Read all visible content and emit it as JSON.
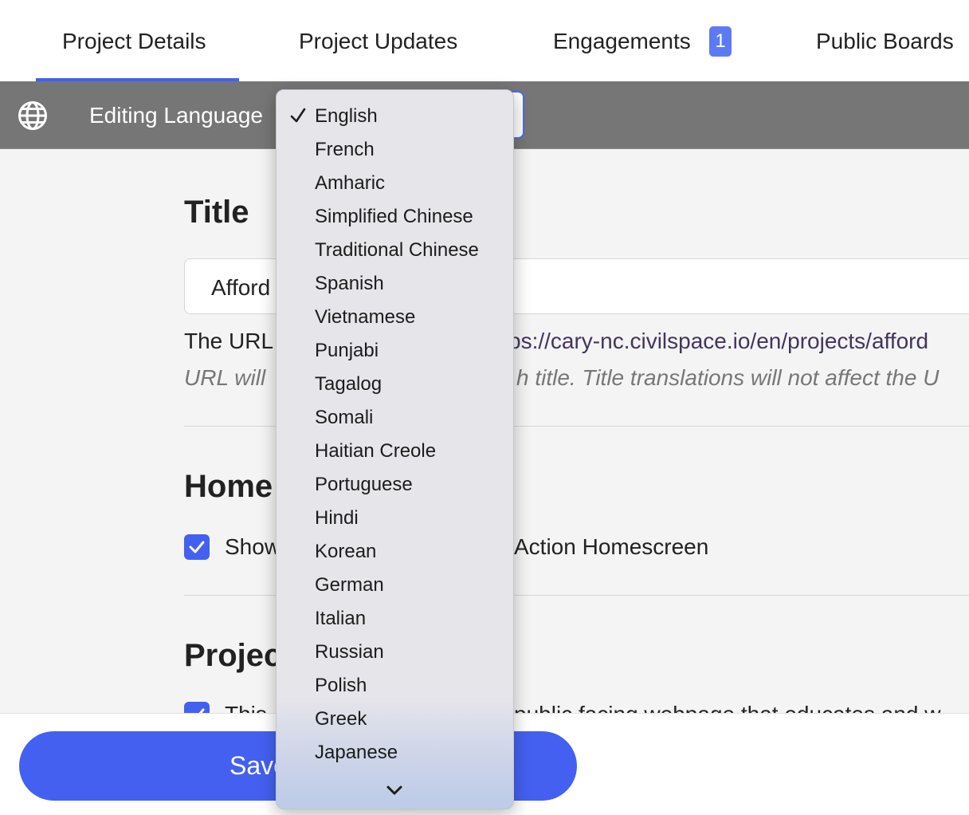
{
  "tabs": [
    {
      "label": "Project Details",
      "active": true
    },
    {
      "label": "Project Updates",
      "active": false
    },
    {
      "label": "Engagements",
      "badge": "1",
      "active": false
    },
    {
      "label": "Public Boards",
      "active": false
    }
  ],
  "language_bar": {
    "label": "Editing Language",
    "icon": "globe-icon"
  },
  "language_menu": {
    "selected": "English",
    "options": [
      "English",
      "French",
      "Amharic",
      "Simplified Chinese",
      "Traditional Chinese",
      "Spanish",
      "Vietnamese",
      "Punjabi",
      "Tagalog",
      "Somali",
      "Haitian Creole",
      "Portuguese",
      "Hindi",
      "Korean",
      "German",
      "Italian",
      "Russian",
      "Polish",
      "Greek",
      "Japanese"
    ]
  },
  "title_section": {
    "heading": "Title",
    "input_value": "Afford",
    "url_prefix": "The URL",
    "url_link": "ps://cary-nc.civilspace.io/en/projects/afford",
    "url_note_left": "URL will",
    "url_note_right": "h title. Title translations will not affect the U"
  },
  "home_section": {
    "heading": "Home",
    "checkbox_left": "Show",
    "checkbox_right": "Action Homescreen",
    "checked": true
  },
  "project_section": {
    "heading": "Projec",
    "checkbox_text": "This",
    "checkbox_text_right": "public facing webpage that educates and w"
  },
  "footer": {
    "save_label": "Save"
  },
  "colors": {
    "accent": "#4360f0",
    "bar": "#767676",
    "badge": "#5d7af5"
  }
}
